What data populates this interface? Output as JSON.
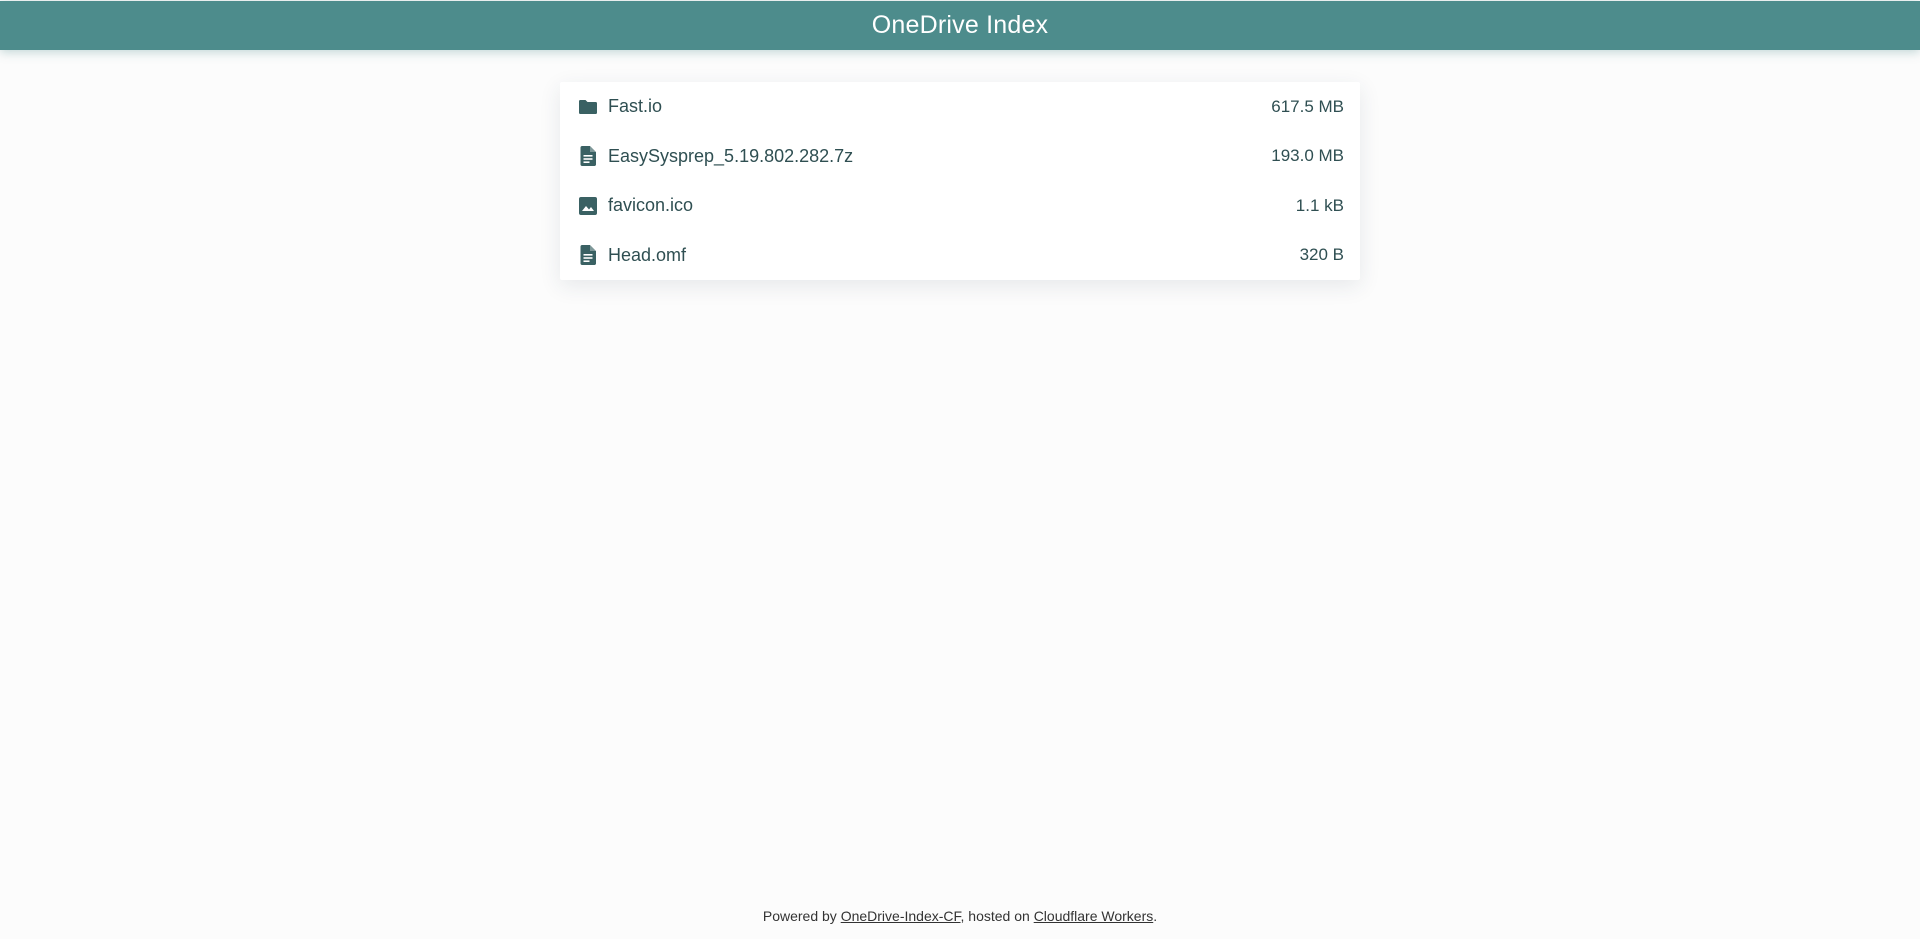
{
  "header": {
    "title": "OneDrive Index"
  },
  "files": [
    {
      "icon": "folder-icon",
      "name": "Fast.io",
      "size": "617.5 MB"
    },
    {
      "icon": "document-icon",
      "name": "EasySysprep_5.19.802.282.7z",
      "size": "193.0 MB"
    },
    {
      "icon": "image-icon",
      "name": "favicon.ico",
      "size": "1.1 kB"
    },
    {
      "icon": "document-icon",
      "name": "Head.omf",
      "size": "320 B"
    }
  ],
  "footer": {
    "prefix": "Powered by ",
    "link1": "OneDrive-Index-CF",
    "middle": ", hosted on ",
    "link2": "Cloudflare Workers",
    "suffix": "."
  },
  "colors": {
    "header_bg": "#4d8c8c",
    "icon": "#3a6163",
    "text": "#2f4f52",
    "page_bg": "#fcfcfc"
  }
}
